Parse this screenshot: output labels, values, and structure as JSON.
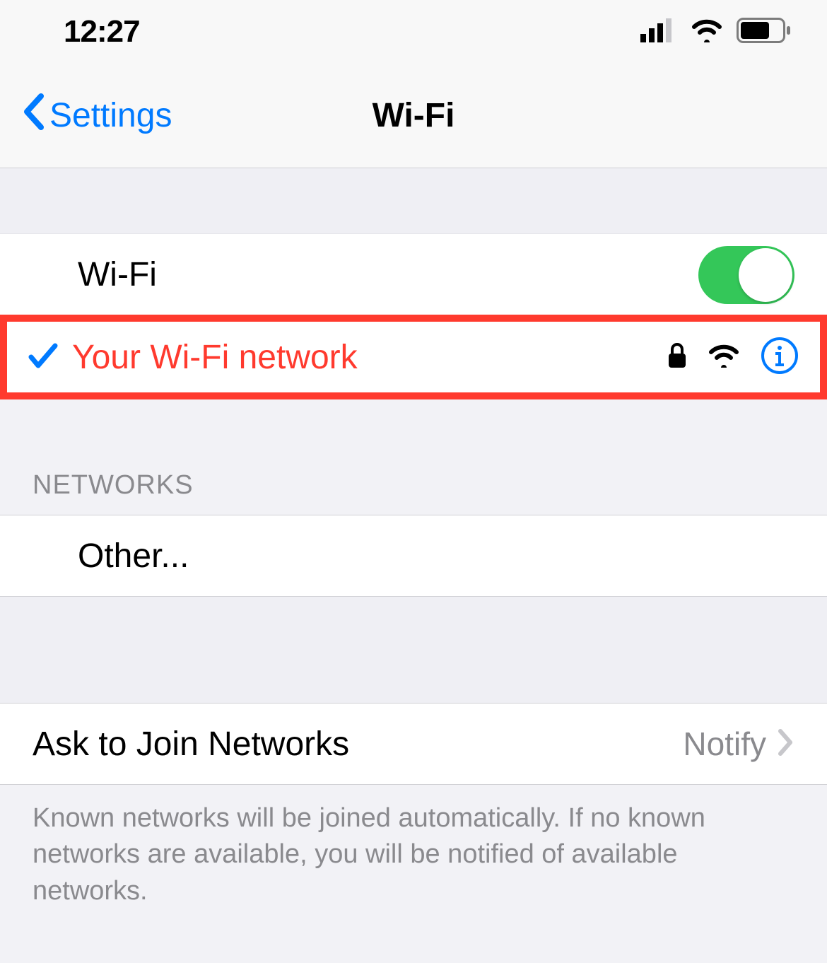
{
  "status": {
    "time": "12:27"
  },
  "nav": {
    "back_label": "Settings",
    "title": "Wi-Fi"
  },
  "wifi_toggle": {
    "label": "Wi-Fi",
    "on": true
  },
  "connected": {
    "name": "Your Wi-Fi network",
    "locked": true
  },
  "networks": {
    "header": "NETWORKS",
    "other_label": "Other..."
  },
  "ask": {
    "label": "Ask to Join Networks",
    "value": "Notify",
    "footer": "Known networks will be joined automatically. If no known networks are available, you will be notified of available networks."
  }
}
